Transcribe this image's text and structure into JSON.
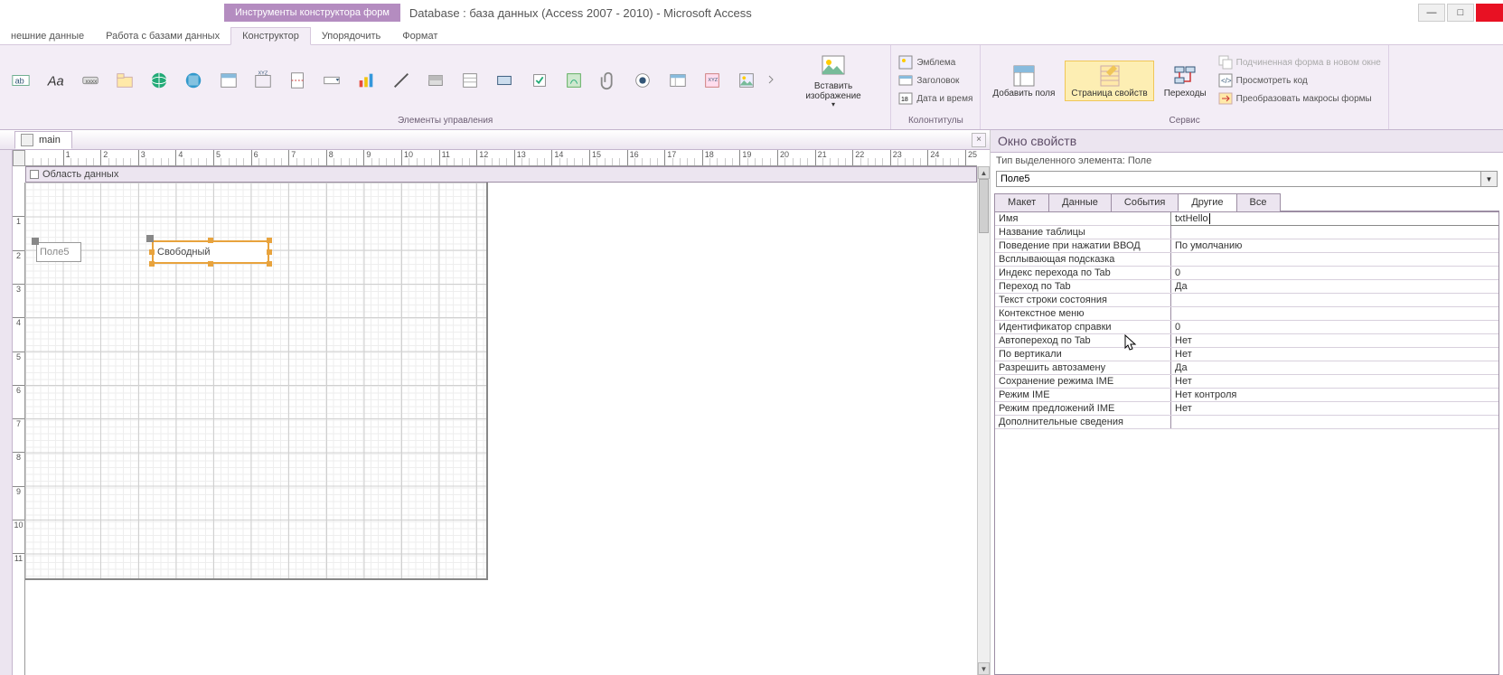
{
  "titlebar": {
    "context_tab": "Инструменты конструктора форм",
    "app_title": "Database : база данных (Access 2007 - 2010) - Microsoft Access"
  },
  "ribbon_tabs": {
    "t0": "нешние данные",
    "t1": "Работа с базами данных",
    "t2": "Конструктор",
    "t3": "Упорядочить",
    "t4": "Формат"
  },
  "ribbon": {
    "g_controls": "Элементы управления",
    "insert_image": "Вставить изображение",
    "emblem": "Эмблема",
    "header": "Заголовок",
    "date_time": "Дата и время",
    "g_headerfooter": "Колонтитулы",
    "add_fields": "Добавить поля",
    "prop_sheet": "Страница свойств",
    "tab_order": "Переходы",
    "subform_new": "Подчиненная форма в новом окне",
    "view_code": "Просмотреть код",
    "convert_macros": "Преобразовать макросы формы",
    "g_tools": "Сервис"
  },
  "doc": {
    "tab_name": "main"
  },
  "section": {
    "detail": "Область данных"
  },
  "controls": {
    "label_text": "Поле5",
    "textbox_text": "Свободный"
  },
  "props": {
    "window_title": "Окно свойств",
    "subtitle": "Тип выделенного элемента: Поле",
    "selector_value": "Поле5",
    "tabs": {
      "layout": "Макет",
      "data": "Данные",
      "events": "События",
      "other": "Другие",
      "all": "Все"
    },
    "rows": [
      {
        "n": "Имя",
        "v": "txtHello",
        "editing": true
      },
      {
        "n": "Название таблицы",
        "v": ""
      },
      {
        "n": "Поведение при нажатии ВВОД",
        "v": "По умолчанию"
      },
      {
        "n": "Всплывающая подсказка",
        "v": ""
      },
      {
        "n": "Индекс перехода по Tab",
        "v": "0"
      },
      {
        "n": "Переход по Tab",
        "v": "Да"
      },
      {
        "n": "Текст строки состояния",
        "v": ""
      },
      {
        "n": "Контекстное меню",
        "v": ""
      },
      {
        "n": "Идентификатор справки",
        "v": "0"
      },
      {
        "n": "Автопереход по Tab",
        "v": "Нет"
      },
      {
        "n": "По вертикали",
        "v": "Нет"
      },
      {
        "n": "Разрешить автозамену",
        "v": "Да"
      },
      {
        "n": "Сохранение режима IME",
        "v": "Нет"
      },
      {
        "n": "Режим IME",
        "v": "Нет контроля"
      },
      {
        "n": "Режим предложений IME",
        "v": "Нет"
      },
      {
        "n": "Дополнительные сведения",
        "v": ""
      }
    ]
  },
  "ruler": {
    "marks": [
      "1",
      "2",
      "3",
      "4",
      "5",
      "6",
      "7",
      "8",
      "9",
      "10",
      "11",
      "12",
      "13",
      "14",
      "15",
      "16",
      "17",
      "18",
      "19",
      "20",
      "21",
      "22",
      "23",
      "24",
      "25"
    ]
  },
  "vruler": {
    "marks": [
      "1",
      "2",
      "3",
      "4",
      "5",
      "6",
      "7",
      "8",
      "9",
      "10",
      "11"
    ]
  }
}
